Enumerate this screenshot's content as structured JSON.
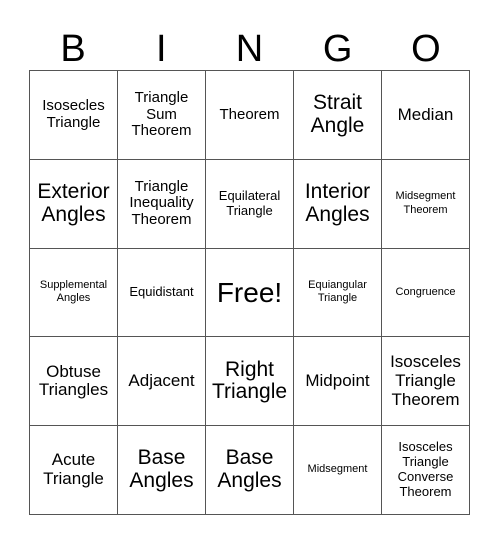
{
  "header": {
    "letters": [
      "B",
      "I",
      "N",
      "G",
      "O"
    ]
  },
  "grid": {
    "rows": 5,
    "columns": 5,
    "border_color": "#555555",
    "background_color": "#ffffff",
    "text_color": "#000000",
    "cells": [
      [
        {
          "label": "Isosecles Triangle",
          "size": "md"
        },
        {
          "label": "Triangle Sum Theorem",
          "size": "md"
        },
        {
          "label": "Theorem",
          "size": "md"
        },
        {
          "label": "Strait Angle",
          "size": "xl"
        },
        {
          "label": "Median",
          "size": "lg"
        }
      ],
      [
        {
          "label": "Exterior Angles",
          "size": "xl"
        },
        {
          "label": "Triangle Inequality Theorem",
          "size": "md"
        },
        {
          "label": "Equilateral Triangle",
          "size": "sm"
        },
        {
          "label": "Interior Angles",
          "size": "xl"
        },
        {
          "label": "Midsegment Theorem",
          "size": "xs"
        }
      ],
      [
        {
          "label": "Supplemental Angles",
          "size": "xs"
        },
        {
          "label": "Equidistant",
          "size": "sm"
        },
        {
          "label": "Free!",
          "size": "free"
        },
        {
          "label": "Equiangular Triangle",
          "size": "xs"
        },
        {
          "label": "Congruence",
          "size": "xs"
        }
      ],
      [
        {
          "label": "Obtuse Triangles",
          "size": "lg"
        },
        {
          "label": "Adjacent",
          "size": "lg"
        },
        {
          "label": "Right Triangle",
          "size": "xl"
        },
        {
          "label": "Midpoint",
          "size": "lg"
        },
        {
          "label": "Isosceles Triangle Theorem",
          "size": "lg"
        }
      ],
      [
        {
          "label": "Acute Triangle",
          "size": "lg"
        },
        {
          "label": "Base Angles",
          "size": "xl"
        },
        {
          "label": "Base Angles",
          "size": "xl"
        },
        {
          "label": "Midsegment",
          "size": "xs"
        },
        {
          "label": "Isosceles Triangle Converse Theorem",
          "size": "sm"
        }
      ]
    ]
  }
}
